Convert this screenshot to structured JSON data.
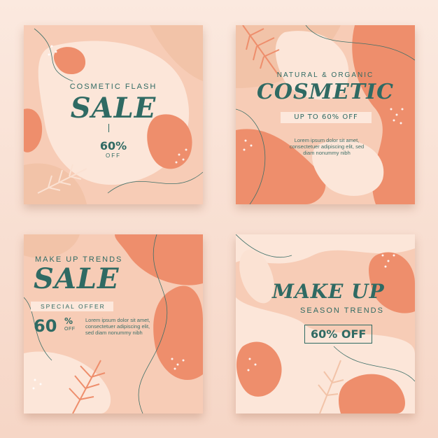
{
  "colors": {
    "teal": "#2f6a63",
    "peach": "#f3b59b",
    "coral": "#ee8e6c",
    "cream": "#fce6d9",
    "sand": "#f2c3a8"
  },
  "cards": [
    {
      "kicker": "COSMETIC FLASH",
      "headline": "SALE",
      "percent": "60%",
      "off": "OFF"
    },
    {
      "kicker": "NATURAL & ORGANIC",
      "headline": "COSMETIC",
      "offer": "UP TO 60% OFF",
      "body": "Lorem ipsum dolor sit amet, consectetuer adipiscing elit, sed diam nonummy nibh"
    },
    {
      "kicker": "MAKE UP TRENDS",
      "headline": "SALE",
      "offer": "SPECIAL OFFER",
      "percent": "60",
      "pct": "%",
      "off": "OFF",
      "body": "Lorem ipsum dolor sit amet, consectetuer adipiscing elit, sed diam nonummy nibh"
    },
    {
      "headline": "MAKE UP",
      "kicker": "SEASON TRENDS",
      "offer": "60% OFF"
    }
  ]
}
